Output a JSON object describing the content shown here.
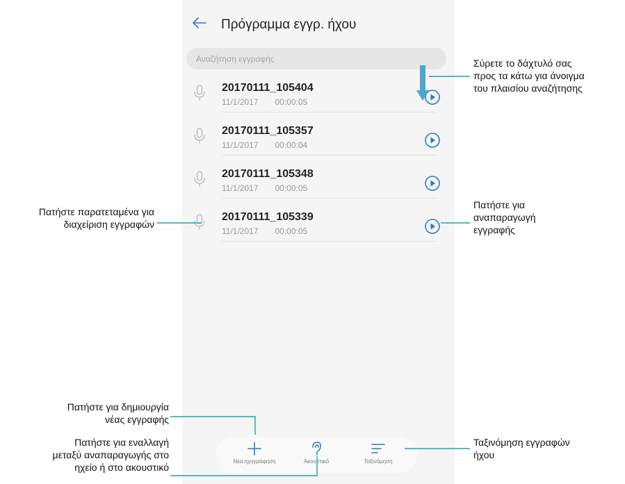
{
  "screen": {
    "title": "Πρόγραμμα εγγρ. ήχου",
    "search_placeholder": "Αναζήτηση εγγραφής"
  },
  "recordings": [
    {
      "name": "20170111_105404",
      "date": "11/1/2017",
      "duration": "00:00:05"
    },
    {
      "name": "20170111_105357",
      "date": "11/1/2017",
      "duration": "00:00:04"
    },
    {
      "name": "20170111_105348",
      "date": "11/1/2017",
      "duration": "00:00:05"
    },
    {
      "name": "20170111_105339",
      "date": "11/1/2017",
      "duration": "00:00:05"
    }
  ],
  "bottom_bar": {
    "new_recording": "Νέα ηχογράφηση",
    "earpiece": "Ακουστικό",
    "sort": "Ταξινόμηση"
  },
  "callouts": {
    "swipe_down": [
      "Σύρετε το δάχτυλό σας",
      "προς τα κάτω για άνοιγμα",
      "του πλαισίου αναζήτησης"
    ],
    "play": [
      "Πατήστε για",
      "αναπαραγωγή",
      "εγγραφής"
    ],
    "long_press": [
      "Πατήστε παρατεταμένα για",
      "διαχείριση εγγραφών"
    ],
    "new_recording": [
      "Πατήστε για δημιουργία",
      "νέας εγγραφής"
    ],
    "toggle_output": [
      "Πατήστε για εναλλαγή",
      "μεταξύ αναπαραγωγής στο",
      "ηχείο ή στο ακουστικό"
    ],
    "sort": [
      "Ταξινόμηση εγγραφών",
      "ήχου"
    ]
  },
  "colors": {
    "accent": "#2a78c8",
    "callout_line": "#1aa6a6",
    "swipe_arrow": "#4aa8cf"
  },
  "icons": {
    "back": "arrow-left-icon",
    "mic": "microphone-icon",
    "play": "play-circle-icon",
    "new": "plus-icon",
    "earpiece": "ear-icon",
    "sort": "sort-lines-icon",
    "swipe": "arrow-down-icon"
  }
}
